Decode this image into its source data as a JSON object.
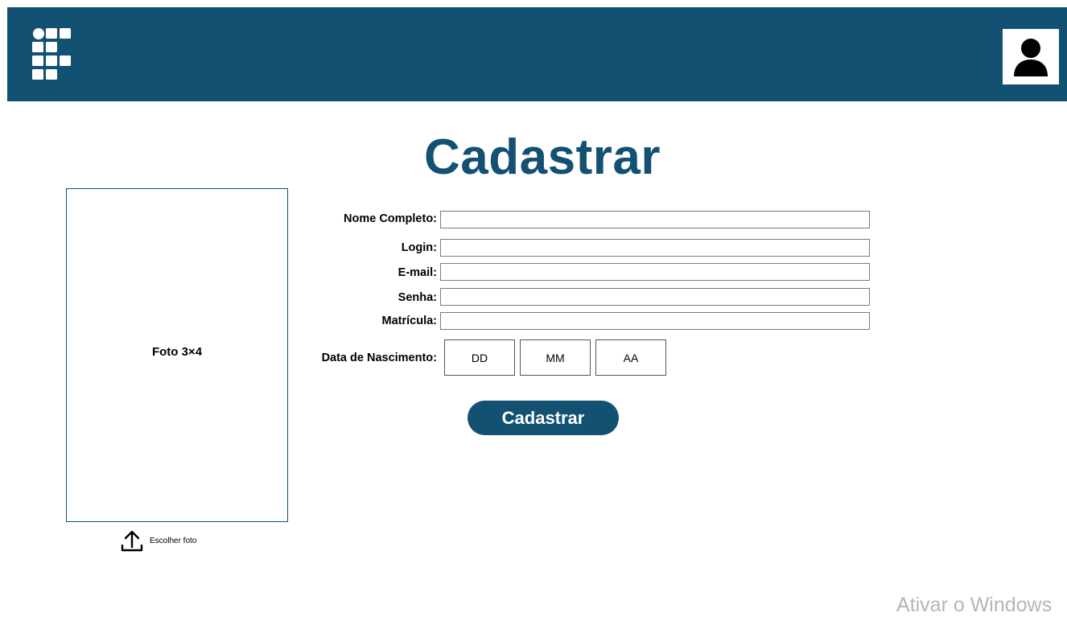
{
  "header": {
    "logo_icon": "institution-logo-icon",
    "avatar_icon": "user-avatar-icon",
    "color": "#135173"
  },
  "title": "Cadastrar",
  "photo": {
    "label": "Foto 3×4",
    "upload_label": "Escolher foto",
    "upload_icon": "upload-icon"
  },
  "form": {
    "fields": [
      {
        "label": "Nome Completo:",
        "value": ""
      },
      {
        "label": "Login:",
        "value": ""
      },
      {
        "label": "E-mail:",
        "value": ""
      },
      {
        "label": "Senha:",
        "value": ""
      },
      {
        "label": "Matrícula:",
        "value": ""
      }
    ],
    "birth_date": {
      "label": "Data de Nascimento:",
      "day": "DD",
      "month": "MM",
      "year": "AA"
    },
    "submit_label": "Cadastrar"
  },
  "os_watermark": "Ativar o Windows"
}
